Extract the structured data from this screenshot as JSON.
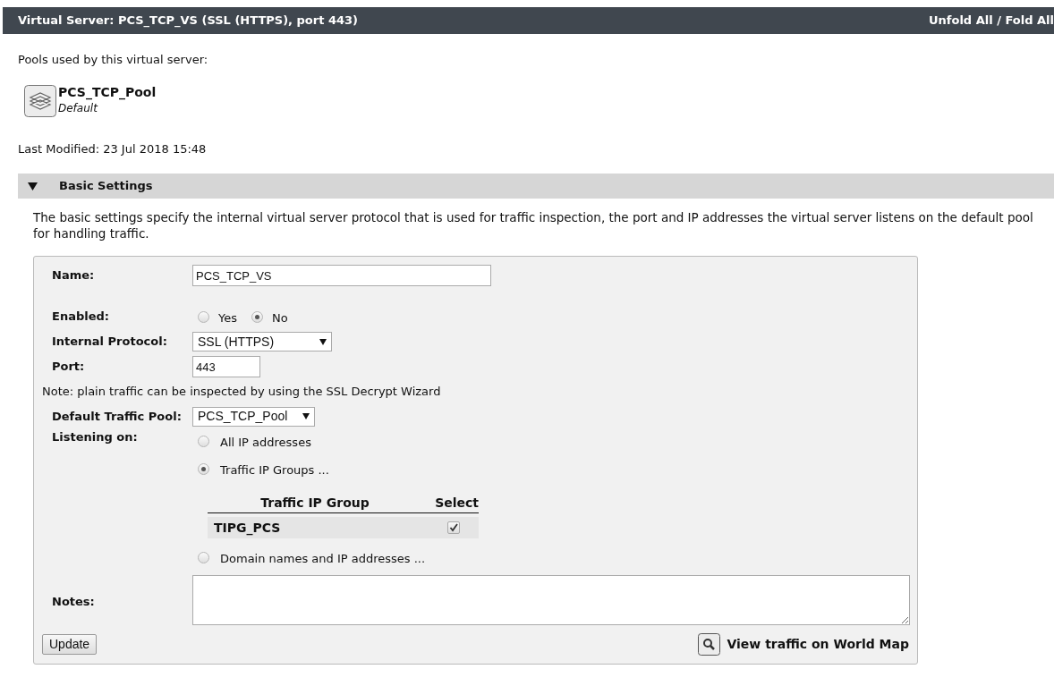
{
  "header": {
    "title": "Virtual Server: PCS_TCP_VS (SSL (HTTPS), port 443)",
    "action": "Unfold All / Fold All"
  },
  "pools_caption": "Pools used by this virtual server:",
  "pools": [
    {
      "name": "PCS_TCP_Pool",
      "note": "Default"
    }
  ],
  "last_modified": "Last Modified: 23 Jul 2018 15:48",
  "section": {
    "title": "Basic Settings",
    "expanded": true,
    "description": "The basic settings specify the internal virtual server protocol that is used for traffic inspection, the port and IP addresses the virtual server listens on the default pool for handling traffic."
  },
  "form": {
    "name": {
      "label": "Name:",
      "value": "PCS_TCP_VS"
    },
    "enabled": {
      "label": "Enabled:",
      "options": [
        {
          "label": "Yes",
          "selected": false
        },
        {
          "label": "No",
          "selected": true
        }
      ]
    },
    "protocol": {
      "label": "Internal Protocol:",
      "value": "SSL (HTTPS)"
    },
    "port": {
      "label": "Port:",
      "value": "443"
    },
    "note": "Note: plain traffic can be inspected by using the SSL Decrypt Wizard",
    "default_pool": {
      "label": "Default Traffic Pool:",
      "value": "PCS_TCP_Pool"
    },
    "listening": {
      "label": "Listening on:",
      "options": [
        {
          "label": "All IP addresses",
          "selected": false
        },
        {
          "label": "Traffic IP Groups ...",
          "selected": true,
          "table": {
            "columns": [
              "Traffic IP Group",
              "Select"
            ],
            "rows": [
              {
                "name": "TIPG_PCS",
                "checked": true
              }
            ]
          }
        },
        {
          "label": "Domain names and IP addresses ...",
          "selected": false
        }
      ]
    },
    "notes": {
      "label": "Notes:"
    },
    "update_button": "Update",
    "map_link": "View traffic on World Map"
  }
}
